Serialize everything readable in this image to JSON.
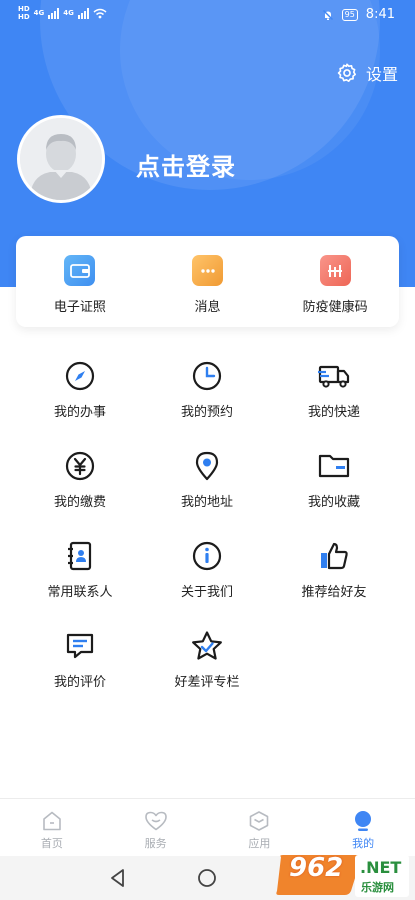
{
  "status_bar": {
    "left_tags": [
      "HD",
      "HD"
    ],
    "network": [
      "4G",
      "4G"
    ],
    "battery": "95",
    "time": "8:41"
  },
  "header": {
    "settings_label": "设置",
    "login_text": "点击登录"
  },
  "quick_cards": [
    {
      "label": "电子证照",
      "icon": "wallet-icon",
      "color": "#4ea3f2"
    },
    {
      "label": "消息",
      "icon": "message-icon",
      "color": "#f5a94a"
    },
    {
      "label": "防疫健康码",
      "icon": "health-code-icon",
      "color": "#f27a6b"
    }
  ],
  "grid": [
    {
      "label": "我的办事",
      "icon": "compass-icon"
    },
    {
      "label": "我的预约",
      "icon": "clock-icon"
    },
    {
      "label": "我的快递",
      "icon": "truck-icon"
    },
    {
      "label": "我的缴费",
      "icon": "yuan-icon"
    },
    {
      "label": "我的地址",
      "icon": "location-icon"
    },
    {
      "label": "我的收藏",
      "icon": "folder-icon"
    },
    {
      "label": "常用联系人",
      "icon": "contacts-icon"
    },
    {
      "label": "关于我们",
      "icon": "info-icon"
    },
    {
      "label": "推荐给好友",
      "icon": "thumbs-up-icon"
    },
    {
      "label": "我的评价",
      "icon": "comment-icon"
    },
    {
      "label": "好差评专栏",
      "icon": "star-icon"
    }
  ],
  "tabs": [
    {
      "label": "首页",
      "icon": "home-icon",
      "active": false
    },
    {
      "label": "服务",
      "icon": "heart-icon",
      "active": false
    },
    {
      "label": "应用",
      "icon": "cube-icon",
      "active": false
    },
    {
      "label": "我的",
      "icon": "profile-icon",
      "active": true
    }
  ],
  "watermark": {
    "number": "962",
    "dot_text": ".NET",
    "sub_text": "乐游网"
  },
  "colors": {
    "primary": "#3f86f4",
    "icon_accent": "#2f7ff0",
    "icon_stroke": "#1c1c1c"
  }
}
